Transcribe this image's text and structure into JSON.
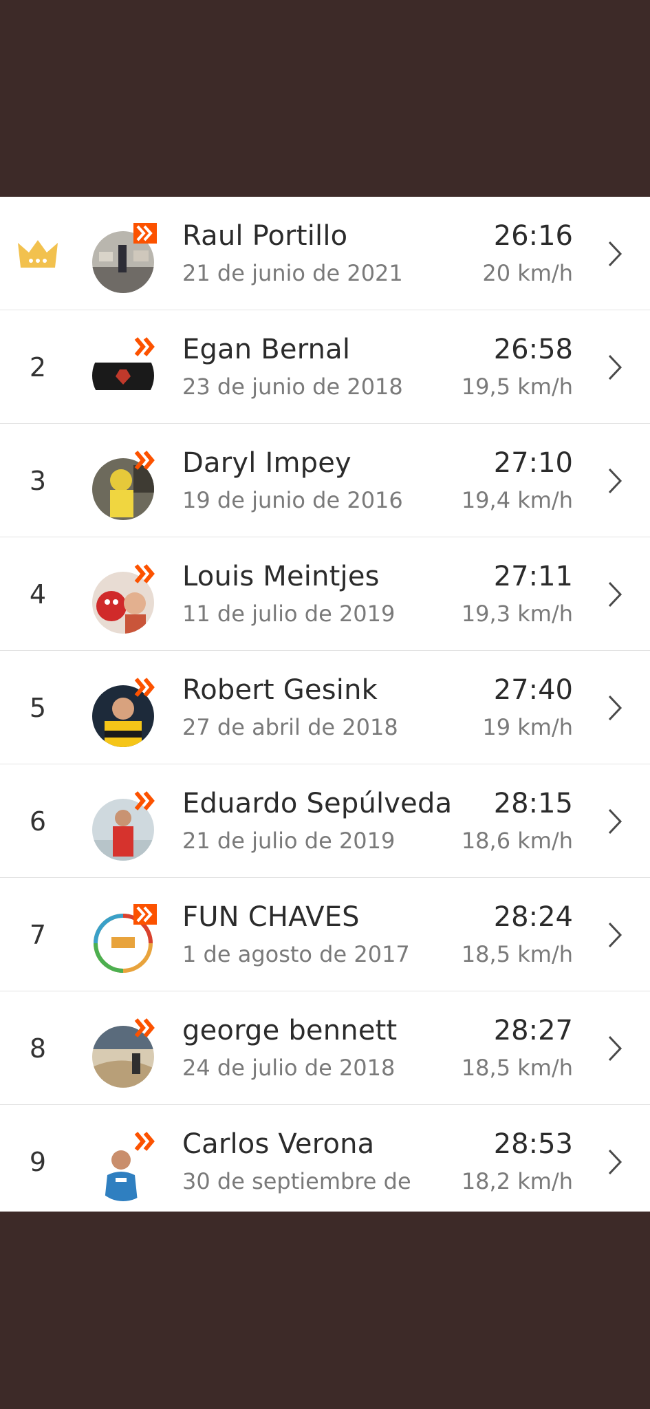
{
  "leaderboard": {
    "rows": [
      {
        "rank": "",
        "is_leader": true,
        "name": "Raul Portillo",
        "date": "21 de junio de 2021",
        "time": "26:16",
        "speed": "20 km/h"
      },
      {
        "rank": "2",
        "is_leader": false,
        "name": "Egan Bernal",
        "date": "23 de junio de 2018",
        "time": "26:58",
        "speed": "19,5 km/h"
      },
      {
        "rank": "3",
        "is_leader": false,
        "name": "Daryl Impey",
        "date": "19 de junio de 2016",
        "time": "27:10",
        "speed": "19,4 km/h"
      },
      {
        "rank": "4",
        "is_leader": false,
        "name": "Louis Meintjes",
        "date": "11 de julio de 2019",
        "time": "27:11",
        "speed": "19,3 km/h"
      },
      {
        "rank": "5",
        "is_leader": false,
        "name": "Robert Gesink",
        "date": "27 de abril de 2018",
        "time": "27:40",
        "speed": "19 km/h"
      },
      {
        "rank": "6",
        "is_leader": false,
        "name": "Eduardo Sepúlveda",
        "date": "21 de julio de 2019",
        "time": "28:15",
        "speed": "18,6 km/h"
      },
      {
        "rank": "7",
        "is_leader": false,
        "name": "FUN CHAVES",
        "date": "1 de agosto de 2017",
        "time": "28:24",
        "speed": "18,5 km/h"
      },
      {
        "rank": "8",
        "is_leader": false,
        "name": "george bennett",
        "date": "24 de julio de 2018",
        "time": "28:27",
        "speed": "18,5 km/h"
      },
      {
        "rank": "9",
        "is_leader": false,
        "name": "Carlos Verona",
        "date": "30 de septiembre de",
        "time": "28:53",
        "speed": "18,2 km/h"
      }
    ]
  },
  "icons": {
    "leader": "crown-icon",
    "badge": "double-chevron-badge-icon",
    "disclosure": "chevron-right-icon"
  },
  "colors": {
    "background": "#3d2a28",
    "crown": "#f2c14e",
    "badge": "#fc5200",
    "chevron": "#4a4a4a"
  }
}
